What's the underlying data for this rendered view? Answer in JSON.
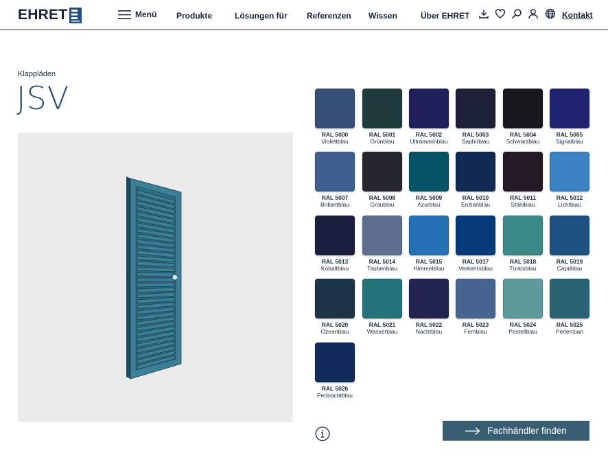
{
  "header": {
    "logo_text": "EHRET",
    "menu_label": "Menü",
    "nav": [
      "Produkte",
      "Lösungen für",
      "Referenzen",
      "Wissen",
      "Über EHRET"
    ],
    "kontakt_label": "Kontakt"
  },
  "product": {
    "category": "Klappläden",
    "title": "JSV",
    "shutter_color": "#3b7f99"
  },
  "swatches": [
    {
      "code": "RAL 5000",
      "name": "Violettblau",
      "color": "#354f76"
    },
    {
      "code": "RAL 5001",
      "name": "Grünblau",
      "color": "#1e3a3c"
    },
    {
      "code": "RAL 5002",
      "name": "Ultramarinblau",
      "color": "#20215a"
    },
    {
      "code": "RAL 5003",
      "name": "Saphirblau",
      "color": "#1c2138"
    },
    {
      "code": "RAL 5004",
      "name": "Schwarzblau",
      "color": "#17181e"
    },
    {
      "code": "RAL 5005",
      "name": "Signalblau",
      "color": "#202372"
    },
    {
      "code": "RAL 5007",
      "name": "Brillantblau",
      "color": "#3d5e8e"
    },
    {
      "code": "RAL 5008",
      "name": "Graublau",
      "color": "#25272e"
    },
    {
      "code": "RAL 5009",
      "name": "Azurblau",
      "color": "#045466"
    },
    {
      "code": "RAL 5010",
      "name": "Enzianblau",
      "color": "#0f2a52"
    },
    {
      "code": "RAL 5011",
      "name": "Stahlblau",
      "color": "#241a26"
    },
    {
      "code": "RAL 5012",
      "name": "Lichtblau",
      "color": "#3b82c0"
    },
    {
      "code": "RAL 5013",
      "name": "Kobaltblau",
      "color": "#1b1f3e"
    },
    {
      "code": "RAL 5014",
      "name": "Taubenblau",
      "color": "#5d6e8f"
    },
    {
      "code": "RAL 5015",
      "name": "Himmelblau",
      "color": "#2571b5"
    },
    {
      "code": "RAL 5017",
      "name": "Verkehrsblau",
      "color": "#053a7a"
    },
    {
      "code": "RAL 5018",
      "name": "Türkisblau",
      "color": "#3b8a88"
    },
    {
      "code": "RAL 5019",
      "name": "Capriblau",
      "color": "#1d5182"
    },
    {
      "code": "RAL 5020",
      "name": "Ozeanblau",
      "color": "#1d3549"
    },
    {
      "code": "RAL 5021",
      "name": "Wasserblau",
      "color": "#25727a"
    },
    {
      "code": "RAL 5022",
      "name": "Nachtblau",
      "color": "#222452"
    },
    {
      "code": "RAL 5023",
      "name": "Fernblau",
      "color": "#486490"
    },
    {
      "code": "RAL 5024",
      "name": "Pastellblau",
      "color": "#5e9a9a"
    },
    {
      "code": "RAL 5025",
      "name": "Perlenzian",
      "color": "#2a6374"
    },
    {
      "code": "RAL 5026",
      "name": "Perlnachtblau",
      "color": "#102a5a"
    }
  ],
  "dealer_button": {
    "label": "Fachhändler finden"
  },
  "colors": {
    "brand_dark": "#16233a",
    "button_bg": "#3a5f72",
    "title_color": "#2d4f6e"
  }
}
